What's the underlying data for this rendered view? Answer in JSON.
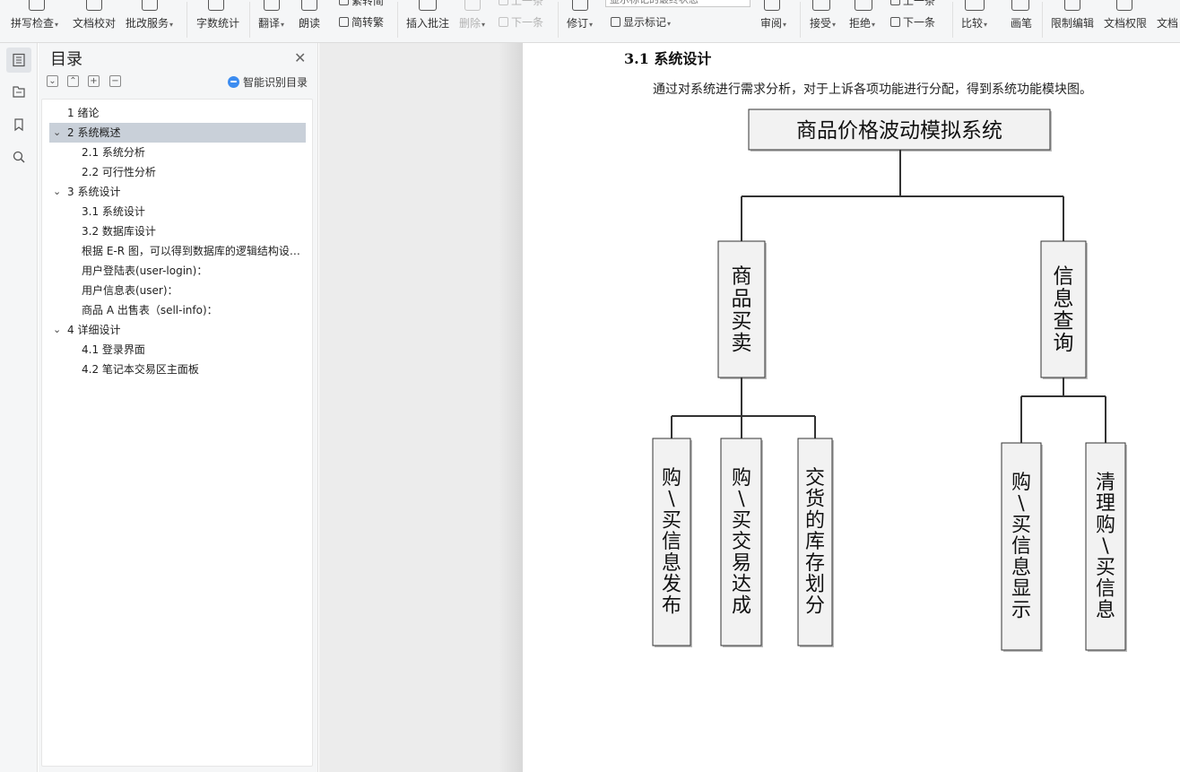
{
  "ribbon": {
    "spell_check": "拼写检查",
    "doc_proof": "文档校对",
    "revise_service": "批改服务",
    "word_count": "字数统计",
    "translate": "翻译",
    "read_aloud": "朗读",
    "trad_to_simp": "繁转简",
    "simp_to_trad": "简转繁",
    "insert_comment": "插入批注",
    "delete": "删除",
    "prev_item": "上一条",
    "next_item": "下一条",
    "track_changes": "修订",
    "markup_state": "显示标记的最终状态",
    "show_markup": "显示标记",
    "review": "审阅",
    "accept": "接受",
    "reject": "拒绝",
    "prev_change": "上一条",
    "next_change": "下一条",
    "compare": "比较",
    "pen": "画笔",
    "restrict_edit": "限制编辑",
    "doc_permission": "文档权限",
    "doc_more": "文档"
  },
  "toc": {
    "title": "目录",
    "smart_detect": "智能识别目录",
    "items": [
      {
        "label": "1 绪论",
        "level": 1,
        "expandable": false,
        "selected": false
      },
      {
        "label": "2 系统概述",
        "level": 1,
        "expandable": true,
        "selected": true
      },
      {
        "label": "2.1  系统分析",
        "level": 2,
        "expandable": false,
        "selected": false
      },
      {
        "label": "2.2  可行性分析",
        "level": 2,
        "expandable": false,
        "selected": false
      },
      {
        "label": "3 系统设计",
        "level": 1,
        "expandable": true,
        "selected": false
      },
      {
        "label": "3.1  系统设计",
        "level": 2,
        "expandable": false,
        "selected": false
      },
      {
        "label": "3.2  数据库设计",
        "level": 2,
        "expandable": false,
        "selected": false
      },
      {
        "label": "根据 E-R 图，可以得到数据库的逻辑结构设计如下",
        "level": 2,
        "expandable": false,
        "selected": false
      },
      {
        "label": "用户登陆表(user-login)：",
        "level": 2,
        "expandable": false,
        "selected": false
      },
      {
        "label": "用户信息表(user)：",
        "level": 2,
        "expandable": false,
        "selected": false
      },
      {
        "label": "商品 A 出售表（sell-info)：",
        "level": 2,
        "expandable": false,
        "selected": false
      },
      {
        "label": "4 详细设计",
        "level": 1,
        "expandable": true,
        "selected": false
      },
      {
        "label": "4.1  登录界面",
        "level": 2,
        "expandable": false,
        "selected": false
      },
      {
        "label": "4.2  笔记本交易区主面板",
        "level": 2,
        "expandable": false,
        "selected": false
      }
    ]
  },
  "document": {
    "heading": "3.1  系统设计",
    "paragraph": "通过对系统进行需求分析，对于上诉各项功能进行分配，得到系统功能模块图。"
  },
  "chart_data": {
    "type": "tree",
    "root": "商品价格波动模拟系统",
    "children": [
      {
        "label": "商品买卖",
        "children": [
          "购\\买信息发布",
          "购\\买交易达成",
          "交货的库存划分"
        ]
      },
      {
        "label": "信息查询",
        "children": [
          "购\\买信息显示",
          "清理购\\买信息"
        ]
      }
    ]
  }
}
